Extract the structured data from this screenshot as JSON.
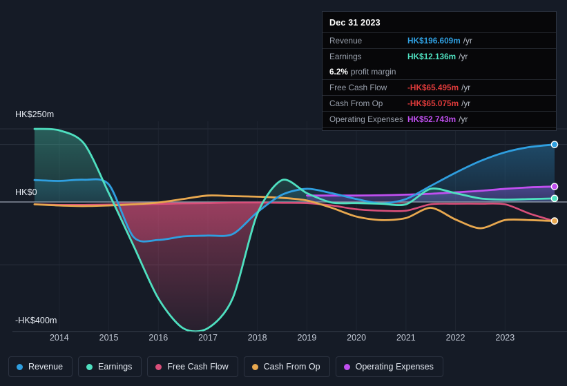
{
  "axes": {
    "y_top_label": "HK$250m",
    "y_zero_label": "HK$0",
    "y_bottom_label": "-HK$400m",
    "x_labels": [
      "2014",
      "2015",
      "2016",
      "2017",
      "2018",
      "2019",
      "2020",
      "2021",
      "2022",
      "2023"
    ]
  },
  "tooltip": {
    "date": "Dec 31 2023",
    "rows": [
      {
        "key": "Revenue",
        "value": "HK$196.609m",
        "unit": "/yr",
        "color": "#2f9fe0"
      },
      {
        "key": "Earnings",
        "value": "HK$12.136m",
        "unit": "/yr",
        "color": "#4fe0c0"
      },
      {
        "key": "Free Cash Flow",
        "value": "-HK$65.495m",
        "unit": "/yr",
        "color": "#e03b3b"
      },
      {
        "key": "Cash From Op",
        "value": "-HK$65.075m",
        "unit": "/yr",
        "color": "#e03b3b"
      },
      {
        "key": "Operating Expenses",
        "value": "HK$52.743m",
        "unit": "/yr",
        "color": "#c04ff0"
      }
    ],
    "margin_value": "6.2%",
    "margin_text": "profit margin"
  },
  "legend": [
    {
      "label": "Revenue",
      "color": "#2f9fe0"
    },
    {
      "label": "Earnings",
      "color": "#4fe0c0"
    },
    {
      "label": "Free Cash Flow",
      "color": "#d94f7a"
    },
    {
      "label": "Cash From Op",
      "color": "#e8a84f"
    },
    {
      "label": "Operating Expenses",
      "color": "#c04ff0"
    }
  ],
  "chart_data": {
    "type": "line",
    "title": "",
    "xlabel": "",
    "ylabel": "HK$",
    "ylim": [
      -400,
      250
    ],
    "grid": true,
    "legend_position": "bottom-left",
    "x": [
      2013.5,
      2014,
      2014.5,
      2015,
      2015.5,
      2016,
      2016.5,
      2017,
      2017.5,
      2018,
      2018.5,
      2019,
      2019.5,
      2020,
      2020.5,
      2021,
      2021.5,
      2022,
      2022.5,
      2023,
      2023.5,
      2024
    ],
    "series": [
      {
        "name": "Revenue",
        "color": "#2f9fe0",
        "values": [
          75,
          72,
          76,
          60,
          -120,
          -130,
          -118,
          -115,
          -110,
          -35,
          25,
          45,
          30,
          10,
          -5,
          10,
          55,
          100,
          140,
          170,
          188,
          196.609
        ]
      },
      {
        "name": "Earnings",
        "color": "#4fe0c0",
        "values": [
          250,
          245,
          200,
          30,
          -150,
          -330,
          -432,
          -432,
          -330,
          -40,
          75,
          30,
          -2,
          -4,
          -6,
          -8,
          45,
          30,
          12,
          8,
          10,
          12.136
        ]
      },
      {
        "name": "Free Cash Flow",
        "color": "#d94f7a",
        "values": [
          -8,
          -10,
          -10,
          -9,
          -8,
          -7,
          -5,
          -4,
          -2,
          -2,
          -3,
          -4,
          -12,
          -25,
          -30,
          -30,
          -8,
          -6,
          -6,
          -8,
          -40,
          -65.495
        ]
      },
      {
        "name": "Cash From Op",
        "color": "#e8a84f",
        "values": [
          -8,
          -12,
          -14,
          -12,
          -8,
          -2,
          10,
          22,
          20,
          18,
          14,
          5,
          -20,
          -50,
          -62,
          -55,
          -20,
          -60,
          -90,
          -62,
          -62,
          -65.075
        ]
      },
      {
        "name": "Operating Expenses",
        "color": "#c04ff0",
        "values": [
          null,
          null,
          null,
          null,
          null,
          null,
          null,
          null,
          null,
          null,
          null,
          22,
          22,
          22,
          23,
          25,
          28,
          33,
          38,
          45,
          50,
          52.743
        ]
      }
    ]
  }
}
